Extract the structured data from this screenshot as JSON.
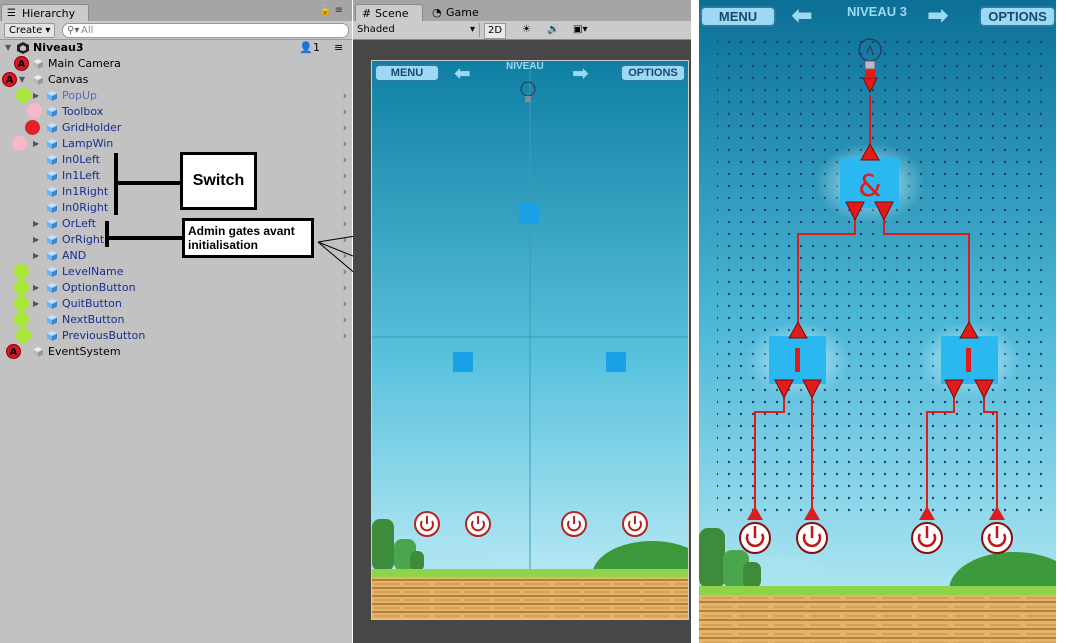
{
  "hierarchy": {
    "tab_label": "Hierarchy",
    "create_label": "Create",
    "search_placeholder": "All",
    "scene_name": "Niveau3",
    "scene_user_count": "1",
    "items": [
      {
        "label": "Main Camera",
        "marker": "A"
      },
      {
        "label": "Canvas",
        "marker": "A"
      },
      {
        "label": "PopUp",
        "marker": "green"
      },
      {
        "label": "Toolbox",
        "marker": "pink"
      },
      {
        "label": "GridHolder",
        "marker": "red"
      },
      {
        "label": "LampWin",
        "marker": "pink"
      },
      {
        "label": "In0Left",
        "marker": ""
      },
      {
        "label": "In1Left",
        "marker": ""
      },
      {
        "label": "In1Right",
        "marker": ""
      },
      {
        "label": "In0Right",
        "marker": ""
      },
      {
        "label": "OrLeft",
        "marker": ""
      },
      {
        "label": "OrRight",
        "marker": ""
      },
      {
        "label": "AND",
        "marker": ""
      },
      {
        "label": "LevelName",
        "marker": "green"
      },
      {
        "label": "OptionButton",
        "marker": "green"
      },
      {
        "label": "QuitButton",
        "marker": "green"
      },
      {
        "label": "NextButton",
        "marker": "green"
      },
      {
        "label": "PreviousButton",
        "marker": "green"
      },
      {
        "label": "EventSystem",
        "marker": "A"
      }
    ],
    "annotations": {
      "switch": "Switch",
      "admin_gates": "Admin gates avant initialisation"
    }
  },
  "scene": {
    "tab_scene": "Scene",
    "tab_game": "Game",
    "shading_mode": "Shaded",
    "mode_2d": "2D",
    "menu_label": "MENU",
    "level_label": "NIVEAU",
    "options_label": "OPTIONS"
  },
  "game": {
    "menu_label": "MENU",
    "level_title": "NIVEAU 3",
    "options_label": "OPTIONS",
    "gate_and_symbol": "&"
  },
  "colors": {
    "sky_top": "#0e7fa3",
    "sky_bottom": "#b9ecf6",
    "wire": "#e11a1a",
    "gate_box": "#2bb7ef",
    "marker_green": "#a8e63a",
    "marker_pink": "#f7b9c9",
    "marker_red": "#e4202b",
    "name_blue": "#1c2d8f"
  },
  "icons": [
    "hierarchy-icon",
    "lock-icon",
    "menu-icon",
    "search-icon",
    "unity-scene-icon",
    "user-icon",
    "gameobject-cube-icon",
    "prefab-cube-icon",
    "chevron-right-icon",
    "sun-icon",
    "audio-icon",
    "image-icon",
    "arrow-left-icon",
    "arrow-right-icon",
    "lightbulb-icon",
    "power-button-icon"
  ]
}
